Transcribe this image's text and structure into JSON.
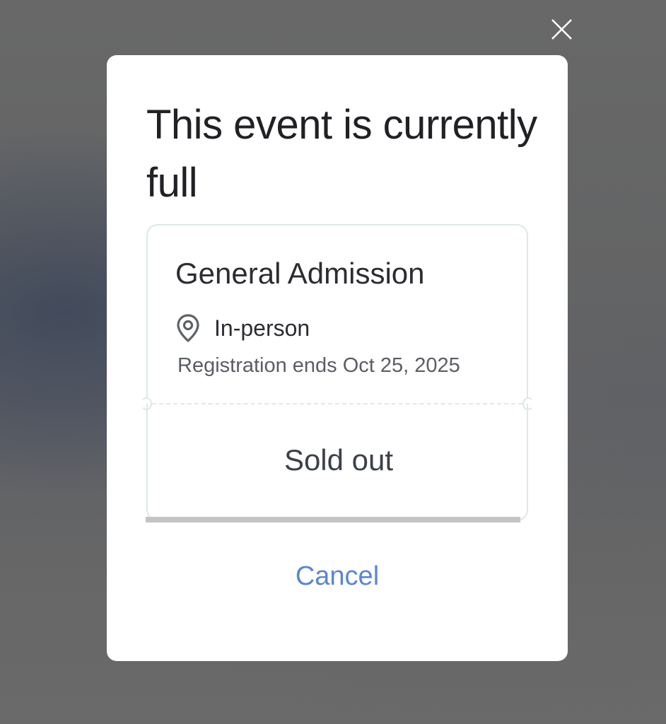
{
  "dialog": {
    "title": "This event is currently full",
    "close_icon": "close-icon",
    "cancel_label": "Cancel"
  },
  "ticket": {
    "name": "General Admission",
    "location_icon": "location-pin-icon",
    "location": "In-person",
    "registration_ends": "Registration ends Oct 25, 2025",
    "status": "Sold out"
  },
  "colors": {
    "accent": "#5a87cf",
    "title_text": "#202124",
    "ticket_border": "#dce9e6",
    "backdrop": "#6e6e6e"
  }
}
